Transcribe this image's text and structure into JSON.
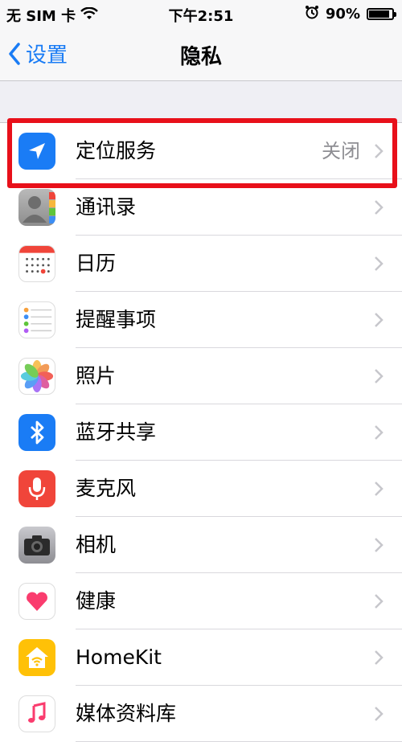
{
  "status_bar": {
    "carrier": "无 SIM 卡",
    "time": "下午2:51",
    "battery_percent": "90%",
    "battery_level": 0.9
  },
  "nav": {
    "back_label": "设置",
    "title": "隐私"
  },
  "rows": [
    {
      "label": "定位服务",
      "value": "关闭",
      "icon": "location-arrow-icon",
      "color": "#1a7cf5"
    },
    {
      "label": "通讯录",
      "value": "",
      "icon": "contacts-icon",
      "color": "#a8a8a8"
    },
    {
      "label": "日历",
      "value": "",
      "icon": "calendar-icon",
      "color": "#ffffff"
    },
    {
      "label": "提醒事项",
      "value": "",
      "icon": "reminders-icon",
      "color": "#ffffff"
    },
    {
      "label": "照片",
      "value": "",
      "icon": "photos-icon",
      "color": "#ffffff"
    },
    {
      "label": "蓝牙共享",
      "value": "",
      "icon": "bluetooth-icon",
      "color": "#1a7cf5"
    },
    {
      "label": "麦克风",
      "value": "",
      "icon": "microphone-icon",
      "color": "#f0453a"
    },
    {
      "label": "相机",
      "value": "",
      "icon": "camera-icon",
      "color": "#8e8e93"
    },
    {
      "label": "健康",
      "value": "",
      "icon": "health-heart-icon",
      "color": "#ffffff"
    },
    {
      "label": "HomeKit",
      "value": "",
      "icon": "homekit-icon",
      "color": "#ffc107"
    },
    {
      "label": "媒体资料库",
      "value": "",
      "icon": "music-icon",
      "color": "#ffffff"
    }
  ]
}
